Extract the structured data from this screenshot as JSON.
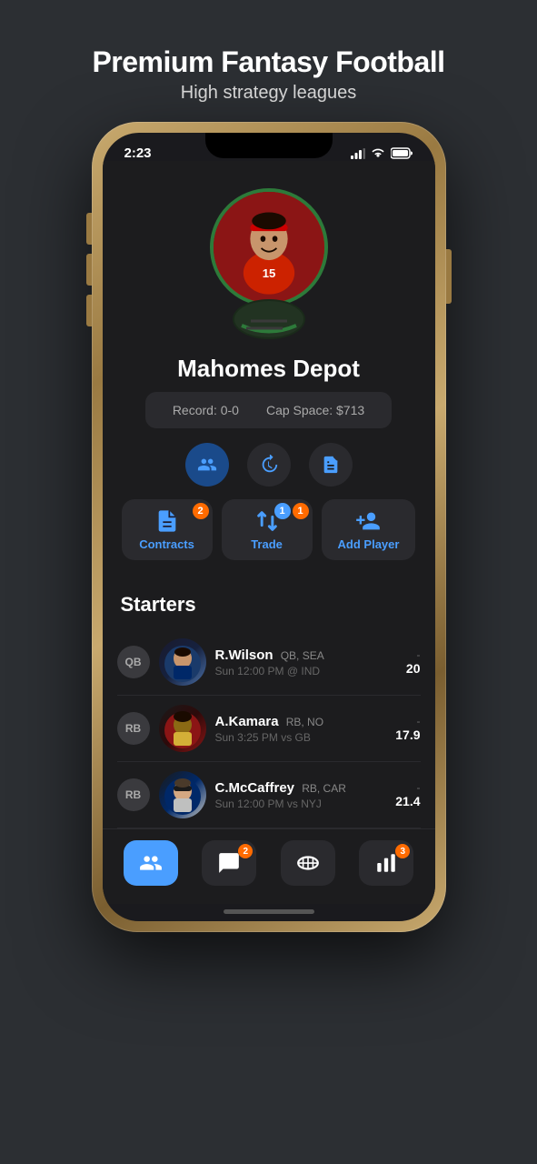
{
  "header": {
    "title": "Premium Fantasy Football",
    "subtitle": "High strategy leagues"
  },
  "statusBar": {
    "time": "2:23",
    "signal": "●●●●",
    "wifi": "wifi",
    "battery": "battery"
  },
  "profile": {
    "teamName": "Mahomes Depot",
    "record": "Record: 0-0",
    "capSpace": "Cap Space: $713"
  },
  "actionIcons": [
    {
      "name": "roster-icon",
      "active": true
    },
    {
      "name": "history-icon",
      "active": false
    },
    {
      "name": "notes-icon",
      "active": false
    }
  ],
  "mainActions": [
    {
      "key": "contracts",
      "label": "Contracts",
      "badge": "2",
      "badgeColor": "orange",
      "active": false
    },
    {
      "key": "trade",
      "label": "Trade",
      "badge1": "1",
      "badge1Color": "blue",
      "badge2": "1",
      "badge2Color": "orange",
      "active": false
    },
    {
      "key": "add-player",
      "label": "Add Player",
      "badge": null,
      "active": false
    }
  ],
  "starters": {
    "title": "Starters",
    "players": [
      {
        "pos": "QB",
        "name": "R.Wilson",
        "posTeam": "QB, SEA",
        "schedule": "Sun 12:00 PM @ IND",
        "scoreDash": "-",
        "score": "20",
        "avatarBg": "wilson-bg"
      },
      {
        "pos": "RB",
        "name": "A.Kamara",
        "posTeam": "RB, NO",
        "schedule": "Sun 3:25 PM vs GB",
        "scoreDash": "-",
        "score": "17.9",
        "avatarBg": "kamara-bg"
      },
      {
        "pos": "RB",
        "name": "C.McCaffrey",
        "posTeam": "RB, CAR",
        "schedule": "Sun 12:00 PM vs NYJ",
        "scoreDash": "-",
        "score": "21.4",
        "avatarBg": "mccaffrey-bg"
      }
    ]
  },
  "tabBar": {
    "tabs": [
      {
        "key": "roster",
        "active": true,
        "badge": null
      },
      {
        "key": "chat",
        "active": false,
        "badge": "2"
      },
      {
        "key": "football",
        "active": false,
        "badge": null
      },
      {
        "key": "stats",
        "active": false,
        "badge": "3"
      }
    ]
  }
}
